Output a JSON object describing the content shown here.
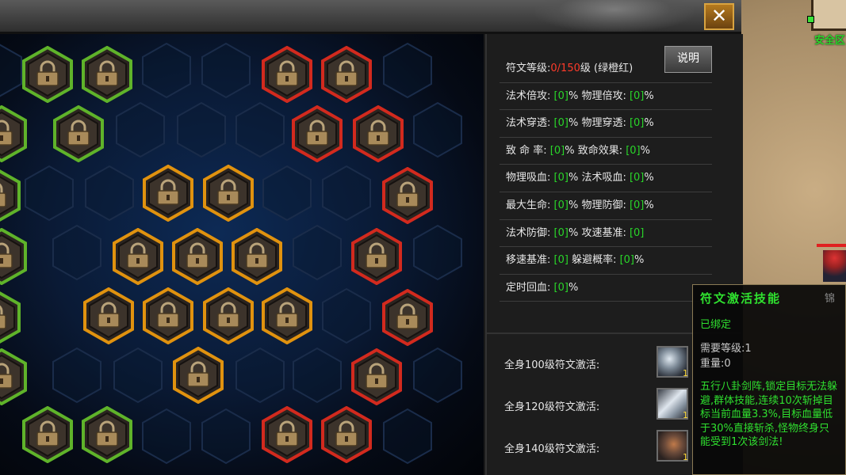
{
  "window": {
    "close_label": "✕"
  },
  "right_scene": {
    "safe_zone_label": "安全区"
  },
  "stats": {
    "rune_level_label": "符文等级:",
    "rune_level_current": "0",
    "rune_level_max": "/150",
    "rune_level_suffix": "级 (绿橙红)",
    "explain_button": "说明",
    "rows": [
      [
        {
          "label": "法术倍攻: ",
          "value": "[0]",
          "unit": "%"
        },
        {
          "label": "物理倍攻: ",
          "value": "[0]",
          "unit": "%"
        }
      ],
      [
        {
          "label": "法术穿透: ",
          "value": "[0]",
          "unit": "%"
        },
        {
          "label": "物理穿透: ",
          "value": "[0]",
          "unit": "%"
        }
      ],
      [
        {
          "label": "致 命 率: ",
          "value": "[0]",
          "unit": "%"
        },
        {
          "label": "致命效果: ",
          "value": "[0]",
          "unit": "%"
        }
      ],
      [
        {
          "label": "物理吸血: ",
          "value": "[0]",
          "unit": "%"
        },
        {
          "label": "法术吸血: ",
          "value": "[0]",
          "unit": "%"
        }
      ],
      [
        {
          "label": "最大生命: ",
          "value": "[0]",
          "unit": "%"
        },
        {
          "label": "物理防御: ",
          "value": "[0]",
          "unit": "%"
        }
      ],
      [
        {
          "label": "法术防御: ",
          "value": "[0]",
          "unit": "%"
        },
        {
          "label": "攻速基准: ",
          "value": "[0]",
          "unit": ""
        }
      ],
      [
        {
          "label": "移速基准: ",
          "value": "[0]",
          "unit": ""
        },
        {
          "label": "躲避概率: ",
          "value": "[0]",
          "unit": "%"
        }
      ],
      [
        {
          "label": "定时回血: ",
          "value": "[0]",
          "unit": "%"
        }
      ]
    ]
  },
  "activations": [
    {
      "label": "全身100级符文激活:",
      "count": "1",
      "icon": "staff-skill-icon"
    },
    {
      "label": "全身120级符文激活:",
      "count": "1",
      "icon": "ice-spike-skill-icon"
    },
    {
      "label": "全身140级符文激活:",
      "count": "1",
      "icon": "warrior-skill-icon"
    }
  ],
  "tooltip": {
    "title": "符文激活技能",
    "bound": "已绑定",
    "required_level": "需要等级:1",
    "weight": "重量:0",
    "description": "五行八卦剑阵,锁定目标无法躲避,群体技能,连续10次斩掉目标当前血量3.3%,目标血量低于30%直接斩杀,怪物终身只能受到1次该剑法!",
    "side_text": "锦"
  },
  "board": {
    "colors": {
      "green": "#5fb32a",
      "orange": "#e0920f",
      "red": "#d22a1e",
      "empty": "#1a2c4a"
    },
    "slots": [
      {
        "id": "g1",
        "color": "green",
        "state": "locked"
      },
      {
        "id": "g2",
        "color": "green",
        "state": "locked"
      },
      {
        "id": "r1",
        "color": "red",
        "state": "locked"
      },
      {
        "id": "r2",
        "color": "red",
        "state": "locked"
      },
      {
        "id": "g3",
        "color": "green",
        "state": "locked"
      },
      {
        "id": "g4",
        "color": "green",
        "state": "locked"
      },
      {
        "id": "r3",
        "color": "red",
        "state": "locked"
      },
      {
        "id": "r4",
        "color": "red",
        "state": "locked"
      },
      {
        "id": "g5",
        "color": "green",
        "state": "locked"
      },
      {
        "id": "o1",
        "color": "orange",
        "state": "locked"
      },
      {
        "id": "o2",
        "color": "orange",
        "state": "locked"
      },
      {
        "id": "r5",
        "color": "red",
        "state": "locked"
      },
      {
        "id": "g6",
        "color": "green",
        "state": "locked"
      },
      {
        "id": "o3",
        "color": "orange",
        "state": "locked"
      },
      {
        "id": "o4",
        "color": "orange",
        "state": "locked"
      },
      {
        "id": "o5",
        "color": "orange",
        "state": "locked"
      },
      {
        "id": "r6",
        "color": "red",
        "state": "locked"
      },
      {
        "id": "g7",
        "color": "green",
        "state": "locked"
      },
      {
        "id": "o6",
        "color": "orange",
        "state": "locked"
      },
      {
        "id": "o7",
        "color": "orange",
        "state": "locked"
      },
      {
        "id": "o8",
        "color": "orange",
        "state": "locked"
      },
      {
        "id": "o9",
        "color": "orange",
        "state": "locked"
      },
      {
        "id": "r7",
        "color": "red",
        "state": "locked"
      },
      {
        "id": "g8",
        "color": "green",
        "state": "locked"
      },
      {
        "id": "o10",
        "color": "orange",
        "state": "locked"
      },
      {
        "id": "r8",
        "color": "red",
        "state": "locked"
      },
      {
        "id": "g9",
        "color": "green",
        "state": "locked"
      },
      {
        "id": "g10",
        "color": "green",
        "state": "locked"
      },
      {
        "id": "r9",
        "color": "red",
        "state": "locked"
      },
      {
        "id": "r10",
        "color": "red",
        "state": "locked"
      }
    ]
  }
}
